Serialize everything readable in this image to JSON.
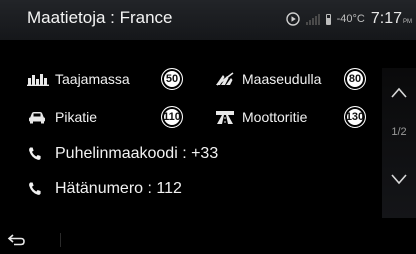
{
  "header": {
    "title": "Maatietoja : France",
    "temperature": "-40",
    "temperature_unit": "°C",
    "clock": "7:17",
    "clock_suffix": "PM"
  },
  "speed_limits": [
    {
      "label": "Taajamassa",
      "limit": "50",
      "icon": "city-buildings-icon"
    },
    {
      "label": "Maaseudulla",
      "limit": "80",
      "icon": "countryside-icon"
    },
    {
      "label": "Pikatie",
      "limit": "110",
      "icon": "car-icon"
    },
    {
      "label": "Moottoritie",
      "limit": "130",
      "icon": "motorway-icon"
    }
  ],
  "info": {
    "phone_code": "Puhelinmaakoodi : +33",
    "emergency": "Hätänumero : 112"
  },
  "pagination": {
    "indicator": "1/2"
  },
  "colors": {
    "background": "#000000",
    "header": "#1c1e22",
    "text": "#f2f2f2",
    "muted": "#9a9a9a"
  }
}
